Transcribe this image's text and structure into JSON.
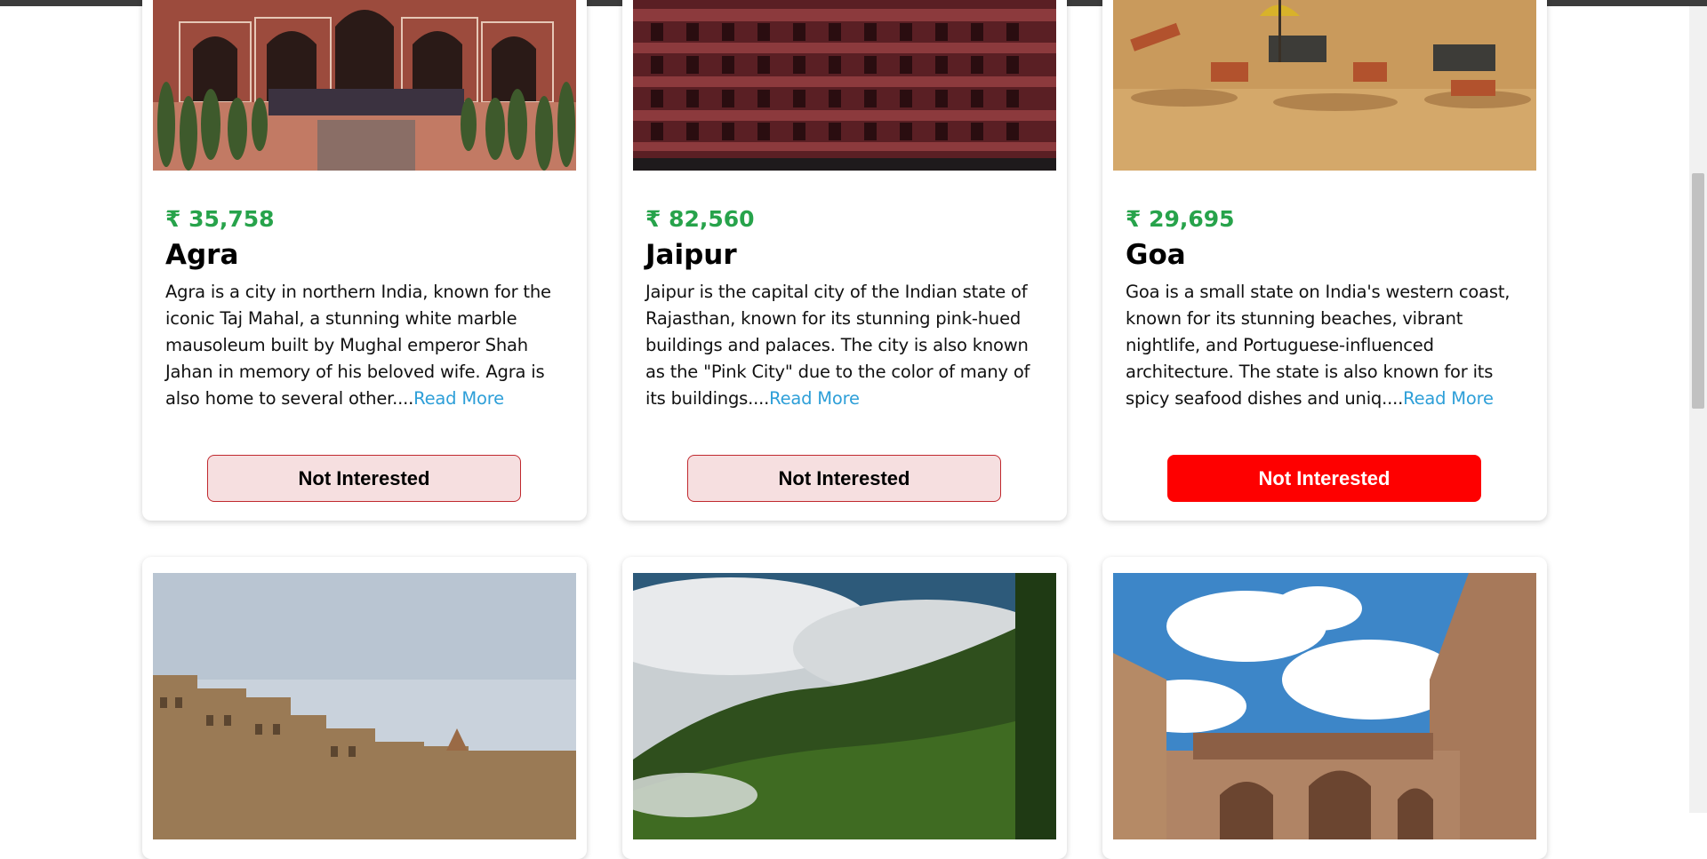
{
  "cards": [
    {
      "price": "₹ 35,758",
      "name": "Agra",
      "description": "Agra is a city in northern India, known for the iconic Taj Mahal, a stunning white marble mausoleum built by Mughal emperor Shah Jahan in memory of his beloved wife. Agra is also home to several other....",
      "read_more": "Read More",
      "button_label": "Not Interested",
      "image_icon": "taj-mahal-photo"
    },
    {
      "price": "₹ 82,560",
      "name": "Jaipur",
      "description": "Jaipur is the capital city of the Indian state of Rajasthan, known for its stunning pink-hued buildings and palaces. The city is also known as the \"Pink City\" due to the color of many of its buildings....",
      "read_more": "Read More",
      "button_label": "Not Interested",
      "image_icon": "hawa-mahal-photo"
    },
    {
      "price": "₹ 29,695",
      "name": "Goa",
      "description": "Goa is a small state on India's western coast, known for its stunning beaches, vibrant nightlife, and Portuguese-influenced architecture. The state is also known for its spicy seafood dishes and uniq....",
      "read_more": "Read More",
      "button_label": "Not Interested",
      "image_icon": "beach-photo"
    },
    {
      "image_icon": "varanasi-ghats-photo"
    },
    {
      "image_icon": "misty-mountains-photo"
    },
    {
      "image_icon": "jodhpur-fort-photo"
    }
  ],
  "colors": {
    "price_green": "#27a34b",
    "read_more_blue": "#2e9fd8",
    "button_active_red": "#fe0000",
    "button_inactive_bg": "#f6dfe0"
  }
}
